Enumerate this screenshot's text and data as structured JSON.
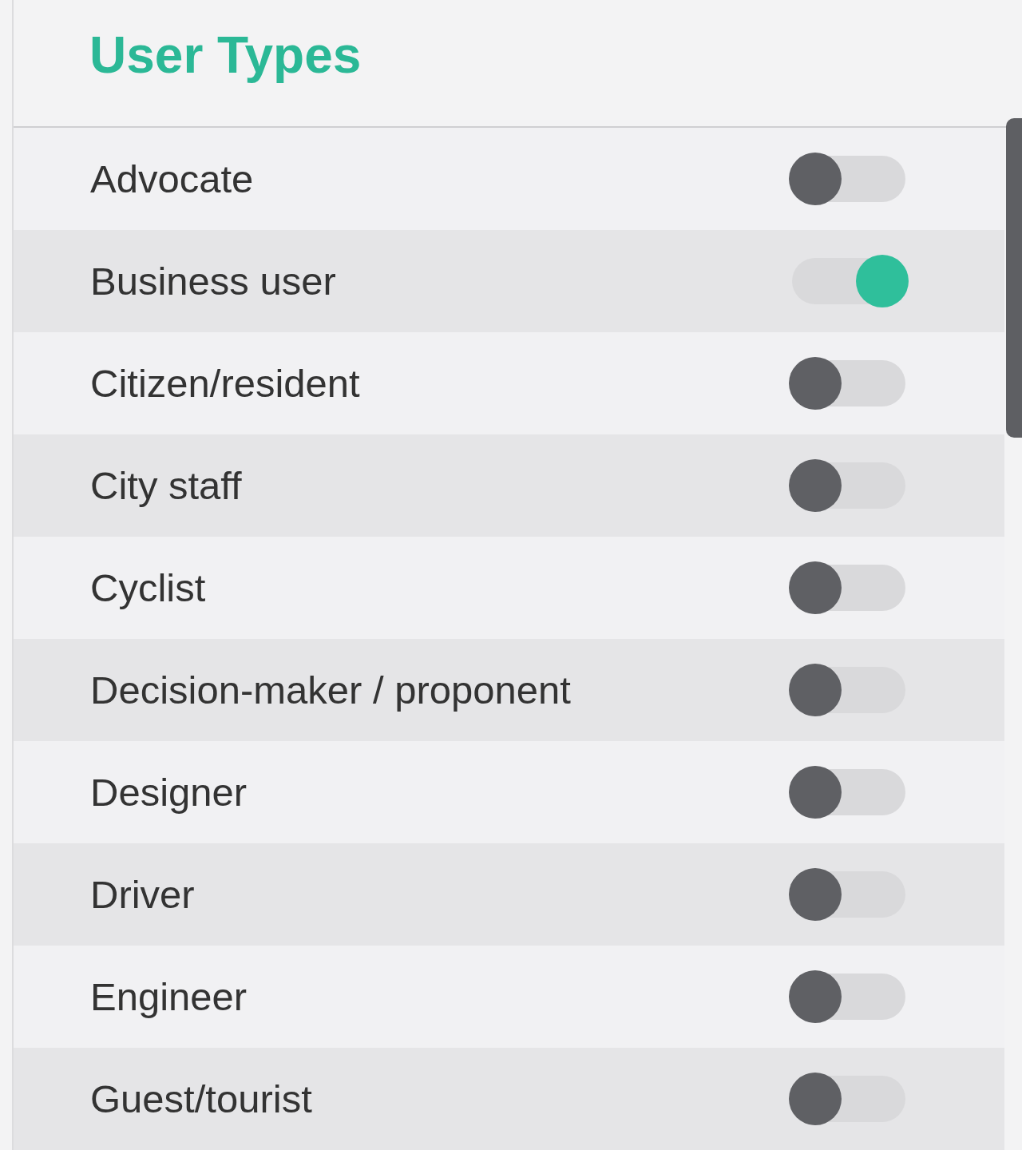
{
  "title": "User Types",
  "items": [
    {
      "label": "Advocate",
      "on": false
    },
    {
      "label": "Business user",
      "on": true
    },
    {
      "label": "Citizen/resident",
      "on": false
    },
    {
      "label": "City staff",
      "on": false
    },
    {
      "label": "Cyclist",
      "on": false
    },
    {
      "label": "Decision-maker / proponent",
      "on": false
    },
    {
      "label": "Designer",
      "on": false
    },
    {
      "label": "Driver",
      "on": false
    },
    {
      "label": "Engineer",
      "on": false
    },
    {
      "label": "Guest/tourist",
      "on": false
    }
  ]
}
